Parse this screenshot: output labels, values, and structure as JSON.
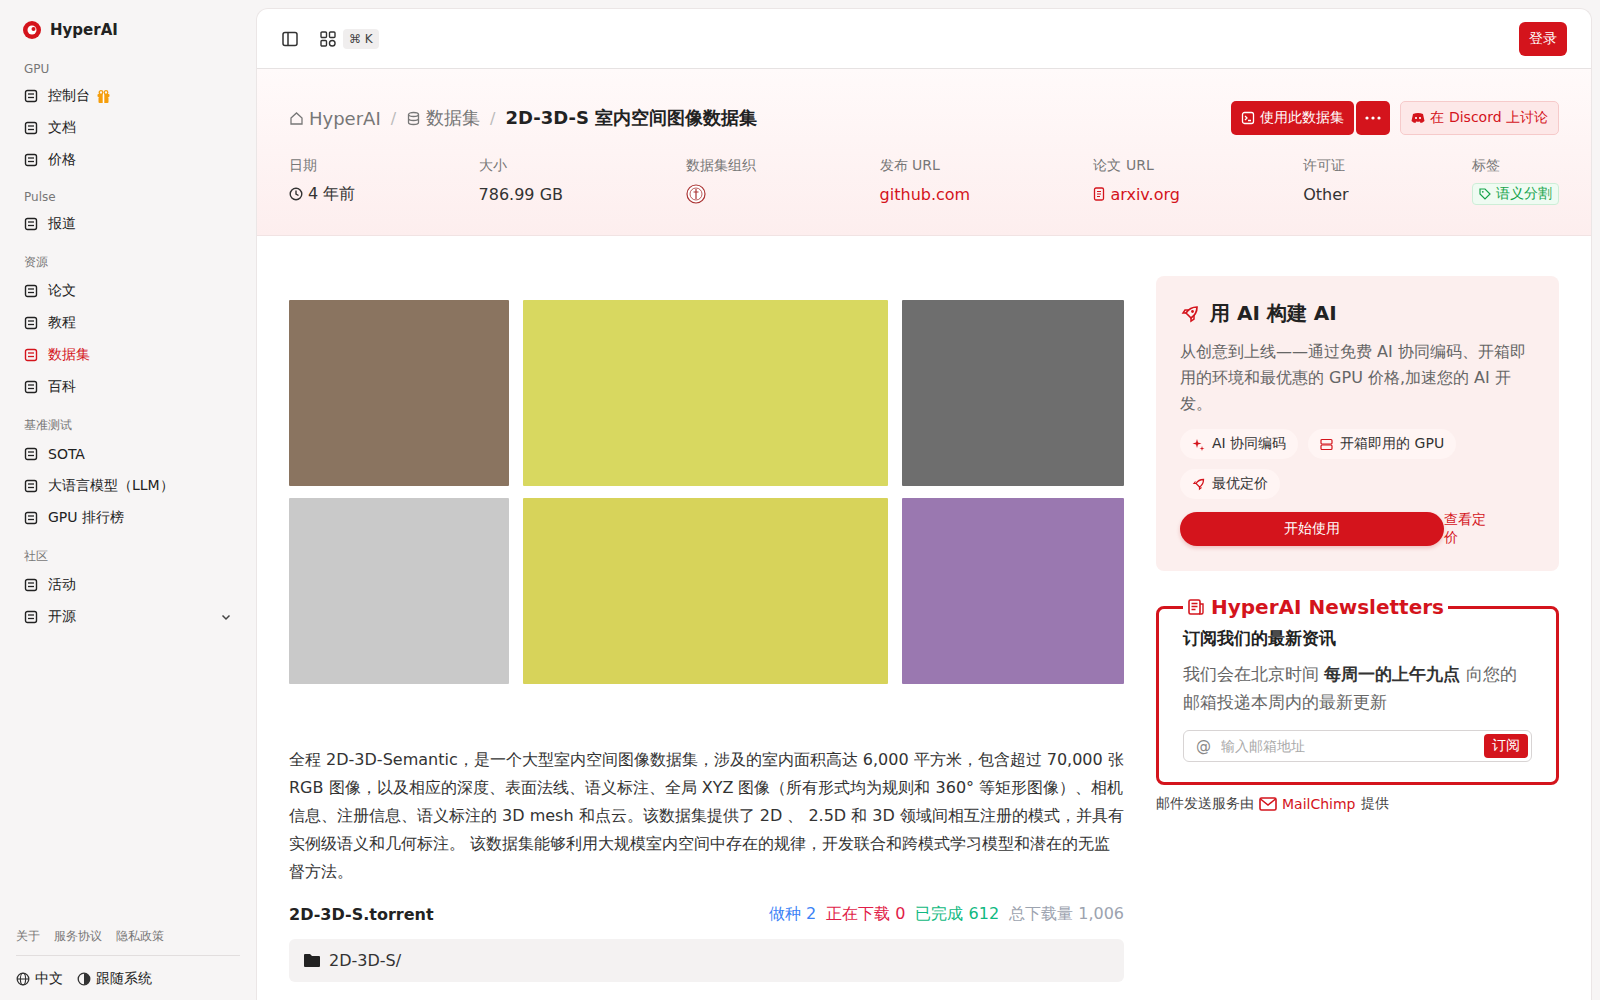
{
  "logo": {
    "name": "HyperAI"
  },
  "sidebar": {
    "sections": [
      {
        "title": "GPU",
        "items": [
          {
            "label": "控制台",
            "selected": false,
            "gift": true,
            "kind": "link"
          },
          {
            "label": "文档",
            "selected": false,
            "gift": false,
            "kind": "link"
          },
          {
            "label": "价格",
            "selected": false,
            "gift": false,
            "kind": "link"
          }
        ]
      },
      {
        "title": "Pulse",
        "items": [
          {
            "label": "报道",
            "selected": false,
            "gift": false,
            "kind": "link"
          }
        ]
      },
      {
        "title": "资源",
        "items": [
          {
            "label": "论文",
            "selected": false,
            "gift": false,
            "kind": "link"
          },
          {
            "label": "教程",
            "selected": false,
            "gift": false,
            "kind": "link"
          },
          {
            "label": "数据集",
            "selected": true,
            "gift": false,
            "kind": "link"
          },
          {
            "label": "百科",
            "selected": false,
            "gift": false,
            "kind": "link"
          }
        ]
      },
      {
        "title": "基准测试",
        "items": [
          {
            "label": "SOTA",
            "selected": false,
            "gift": false,
            "kind": "link"
          },
          {
            "label": "大语言模型（LLM）",
            "selected": false,
            "gift": false,
            "kind": "link"
          },
          {
            "label": "GPU 排行榜",
            "selected": false,
            "gift": false,
            "kind": "link"
          }
        ]
      },
      {
        "title": "社区",
        "items": [
          {
            "label": "活动",
            "selected": false,
            "gift": false,
            "kind": "link"
          },
          {
            "label": "开源",
            "selected": false,
            "gift": false,
            "kind": "group"
          }
        ]
      }
    ],
    "footer_links": [
      "关于",
      "服务协议",
      "隐私政策"
    ],
    "language": "中文",
    "theme": "跟随系统"
  },
  "topbar": {
    "shortcut": "⌘ K",
    "login": "登录"
  },
  "breadcrumb": {
    "separator": "/",
    "items": [
      "HyperAI",
      "数据集",
      "2D-3D-S 室内空间图像数据集"
    ]
  },
  "actions": {
    "use": "使用此数据集",
    "discord": "在 Discord 上讨论"
  },
  "meta": [
    {
      "label": "日期",
      "value": "4 年前",
      "kind": "time"
    },
    {
      "label": "大小",
      "value": "786.99 GB",
      "kind": "text"
    },
    {
      "label": "数据集组织",
      "kind": "org"
    },
    {
      "label": "发布 URL",
      "value": "github.com",
      "kind": "link"
    },
    {
      "label": "论文 URL",
      "value": "arxiv.org",
      "kind": "paper"
    },
    {
      "label": "许可证",
      "value": "Other",
      "kind": "text"
    },
    {
      "label": "标签",
      "value": "语义分割",
      "kind": "tag"
    }
  ],
  "description": "全程 2D-3D-Semantic，是一个大型室内空间图像数据集，涉及的室内面积高达 6,000 平方米，包含超过 70,000 张 RGB 图像，以及相应的深度、表面法线、语义标注、全局 XYZ 图像（所有形式均为规则和 360° 等矩形图像）、相机信息、注册信息、语义标注的 3D mesh 和点云。该数据集提供了 2D 、 2.5D 和 3D 领域间相互注册的模式，并具有实例级语义和几何标注。 该数据集能够利用大规模室内空间中存在的规律，开发联合和跨模式学习模型和潜在的无监督方法。",
  "torrent": {
    "name": "2D-3D-S.torrent",
    "stats": [
      {
        "label": "做种",
        "value": "2",
        "color": "#3b82f6"
      },
      {
        "label": "正在下载",
        "value": "0",
        "color": "#e11d48"
      },
      {
        "label": "已完成",
        "value": "612",
        "color": "#10b981"
      },
      {
        "label": "总下载量",
        "value": "1,006",
        "color": "#9ca3af"
      }
    ],
    "files": [
      {
        "name": "2D-3D-S/",
        "kind": "folder"
      }
    ]
  },
  "promo": {
    "title": "用 AI 构建 AI",
    "text": "从创意到上线——通过免费 AI 协同编码、开箱即用的环境和最优惠的 GPU 价格,加速您的 AI 开发。",
    "chips": [
      "AI 协同编码",
      "开箱即用的 GPU",
      "最优定价"
    ],
    "primary": "开始使用",
    "link": "查看定价"
  },
  "newsletter": {
    "title": "HyperAI Newsletters",
    "subtitle": "订阅我们的最新资讯",
    "text_before": "我们会在北京时间 ",
    "text_bold": "每周一的上午九点",
    "text_after": " 向您的邮箱投递本周内的最新更新",
    "icon": "@",
    "placeholder": "输入邮箱地址",
    "button": "订阅",
    "footer_before": "邮件发送服务由 ",
    "footer_link": "MailChimp",
    "footer_after": " 提供"
  }
}
